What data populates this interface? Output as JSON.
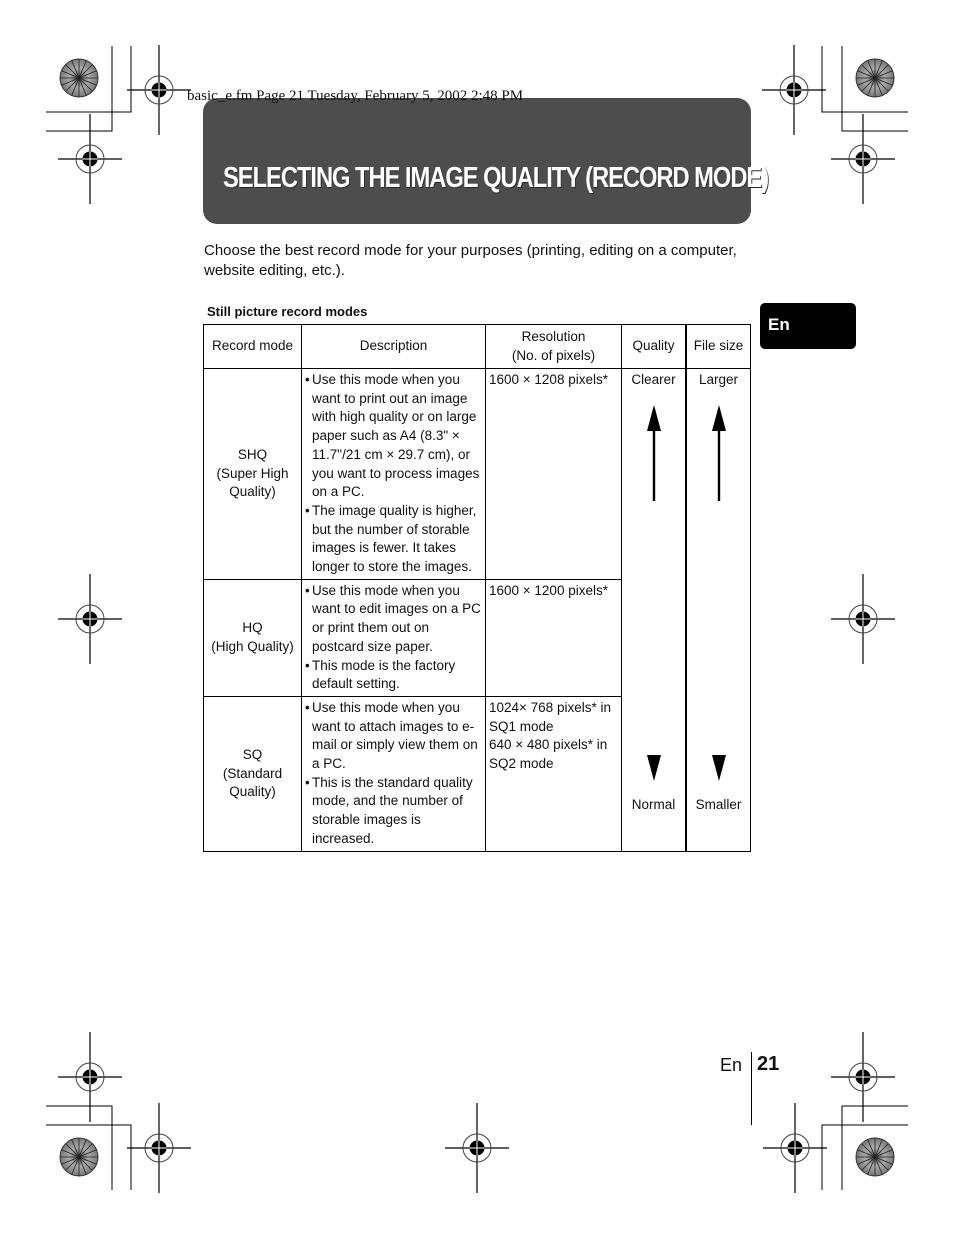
{
  "file_header": "basic_e.fm  Page 21  Tuesday, February 5, 2002  2:48 PM",
  "title": "SELECTING THE IMAGE QUALITY (RECORD MODE)",
  "intro": "Choose the best record mode for your purposes (printing, editing on a computer, website editing, etc.).",
  "language_tab": "En",
  "table": {
    "caption": "Still picture record modes",
    "headers": {
      "mode": "Record mode",
      "description": "Description",
      "resolution_line1": "Resolution",
      "resolution_line2": "(No. of pixels)",
      "quality": "Quality",
      "file_size": "File size"
    },
    "rows": [
      {
        "mode_line1": "SHQ",
        "mode_line2": "(Super High",
        "mode_line3": "Quality)",
        "bullets": [
          "Use this mode when you want to print out an image with high quality or on large paper such as A4 (8.3\" × 11.7\"/21 cm × 29.7 cm), or you want to process images on a PC.",
          "The image quality is higher, but the number of storable images is fewer. It takes longer to store the images."
        ],
        "resolution": "1600 × 1208 pixels*"
      },
      {
        "mode_line1": "HQ",
        "mode_line2": "(High Quality)",
        "mode_line3": "",
        "bullets": [
          "Use this mode when you want to edit images on a PC or print them out on postcard size paper.",
          "This mode is the factory default setting."
        ],
        "resolution": "1600 × 1200 pixels*"
      },
      {
        "mode_line1": "SQ",
        "mode_line2": "(Standard",
        "mode_line3": "Quality)",
        "bullets": [
          "Use this mode when you want to attach images to e-mail or simply view them on a PC.",
          "This is the standard quality mode, and the number of storable images is increased."
        ],
        "resolution_line1": "1024× 768 pixels* in SQ1 mode",
        "resolution_line2": "640 × 480 pixels* in SQ2 mode"
      }
    ],
    "quality_scale": {
      "top": "Clearer",
      "bottom": "Normal",
      "arrow_icon": "double-arrow-vertical"
    },
    "file_size_scale": {
      "top": "Larger",
      "bottom": "Smaller",
      "arrow_icon": "double-arrow-vertical"
    }
  },
  "footer": {
    "language": "En",
    "page_number": "21"
  }
}
